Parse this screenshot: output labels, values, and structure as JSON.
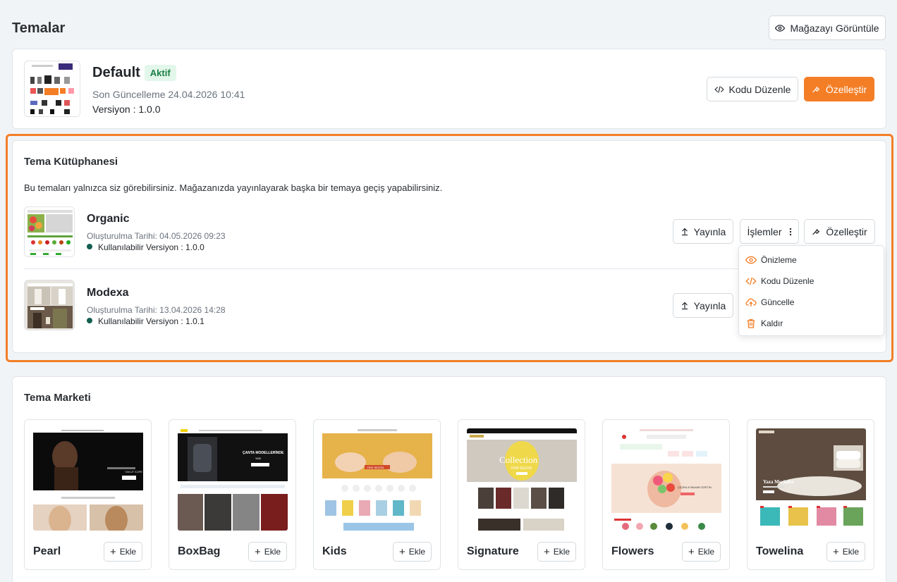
{
  "page": {
    "title": "Temalar"
  },
  "header": {
    "view_store_label": "Mağazayı Görüntüle"
  },
  "active_theme": {
    "name": "Default",
    "badge": "Aktif",
    "updated": "Son Güncelleme 24.04.2026 10:41",
    "version": "Versiyon : 1.0.0",
    "edit_code_label": "Kodu Düzenle",
    "customize_label": "Özelleştir"
  },
  "library": {
    "title": "Tema Kütüphanesi",
    "description": "Bu temaları yalnızca siz görebilirsiniz. Mağazanızda yayınlayarak başka bir temaya geçiş yapabilirsiniz.",
    "themes": [
      {
        "name": "Organic",
        "created": "Oluşturulma Tarihi: 04.05.2026 09:23",
        "version": "Kullanılabilir Versiyon : 1.0.0"
      },
      {
        "name": "Modexa",
        "created": "Oluşturulma Tarihi: 13.04.2026 14:28",
        "version": "Kullanılabilir Versiyon : 1.0.1"
      }
    ],
    "publish_label": "Yayınla",
    "actions_label": "İşlemler",
    "customize_label": "Özelleştir",
    "menu": [
      {
        "label": "Önizleme",
        "icon": "eye-icon"
      },
      {
        "label": "Kodu Düzenle",
        "icon": "code-icon"
      },
      {
        "label": "Güncelle",
        "icon": "cloud-upload-icon"
      },
      {
        "label": "Kaldır",
        "icon": "trash-icon"
      }
    ]
  },
  "market": {
    "title": "Tema Marketi",
    "add_label": "Ekle",
    "themes": [
      {
        "name": "Pearl",
        "banner": "YAKUT KÜPE"
      },
      {
        "name": "BoxBag",
        "banner": "ÇANTA MODELLERİNDE",
        "sub": "%30"
      },
      {
        "name": "Kids",
        "banner": "YENİ SEZON"
      },
      {
        "name": "Signature",
        "banner": "Collection",
        "sub": "YENİ SEZON"
      },
      {
        "name": "Flowers",
        "banner": "ÇİÇEKLE BAHAR ÖZETİN"
      },
      {
        "name": "Towelina",
        "banner": "Yaza Merhaba"
      }
    ]
  },
  "colors": {
    "accent": "#f47e26",
    "active_badge_bg": "#e3f6ea",
    "active_badge_text": "#1a7f44",
    "status_dot": "#135e50"
  }
}
